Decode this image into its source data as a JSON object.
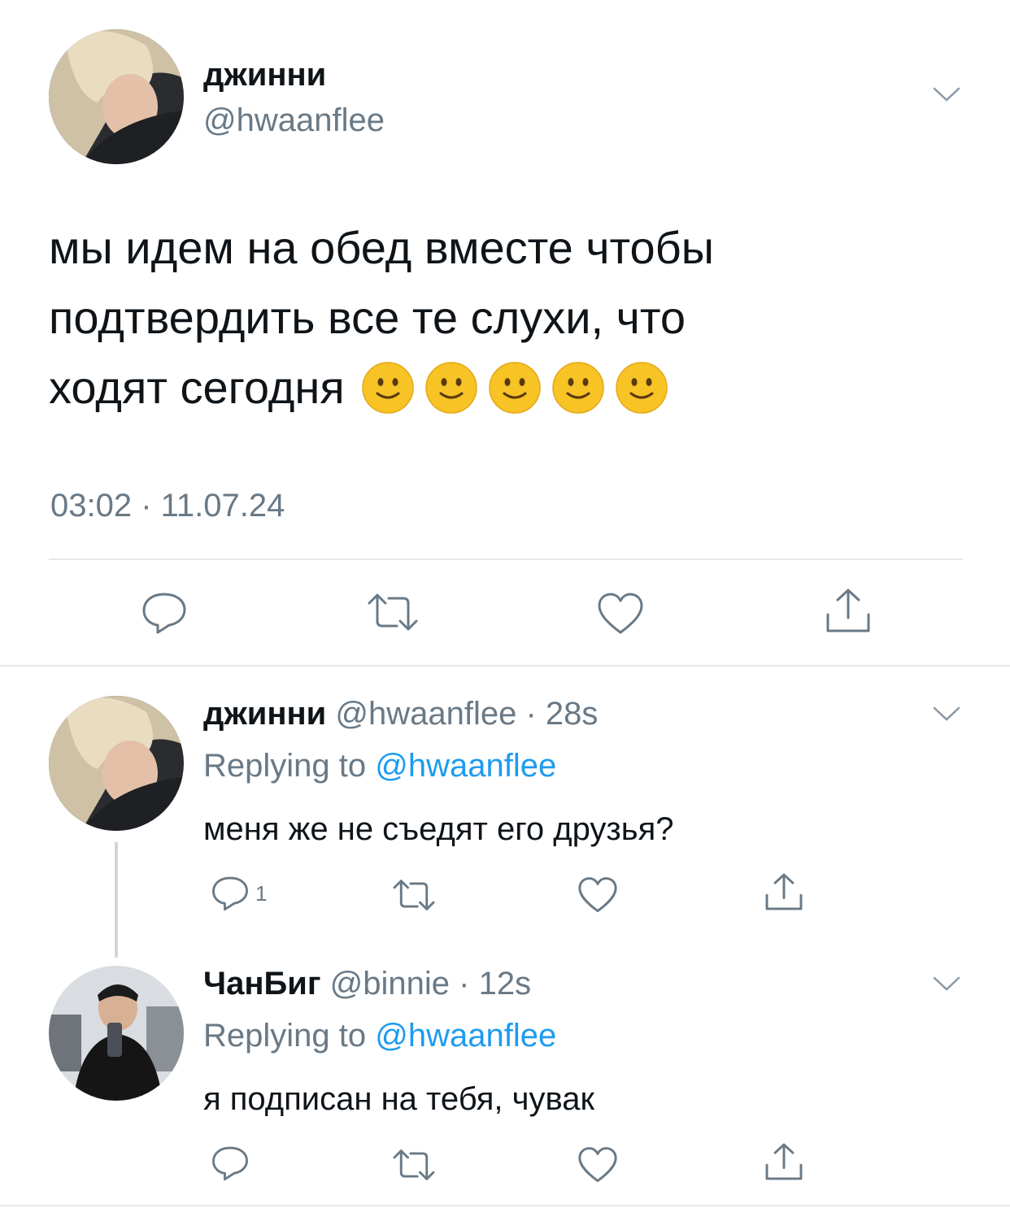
{
  "main_tweet": {
    "author_name": "джинни",
    "handle": "@hwaanflee",
    "text_lines": [
      "мы идем на обед вместе чтобы",
      "подтвердить все те слухи, что",
      "ходят сегодня"
    ],
    "emojis": [
      "slightly-smiling-face",
      "slightly-smiling-face",
      "slightly-smiling-face",
      "slightly-smiling-face",
      "slightly-smiling-face"
    ],
    "timestamp": "03:02 · 11.07.24"
  },
  "replies": [
    {
      "author_name": "джинни",
      "handle": "@hwaanflee",
      "time": "· 28s",
      "replying_label": "Replying to",
      "replying_handle": "@hwaanflee",
      "text": "меня же не съедят его друзья?",
      "reply_count": "1"
    },
    {
      "author_name": "ЧанБиг",
      "handle": "@binnie",
      "time": "· 12s",
      "replying_label": "Replying to",
      "replying_handle": "@hwaanflee",
      "text": "я подписан на тебя, чувак",
      "reply_count": ""
    }
  ],
  "colors": {
    "text": "#0f1419",
    "muted": "#697986",
    "link": "#1d9bf0",
    "divider": "#e6e9eb",
    "emoji": "#f7c325"
  }
}
